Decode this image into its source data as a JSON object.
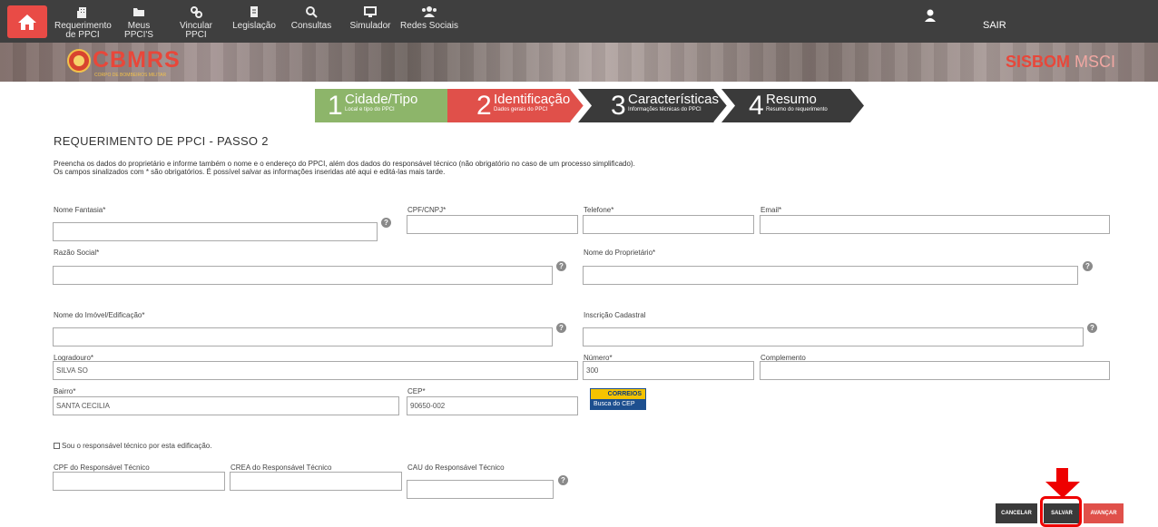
{
  "nav": {
    "items": [
      {
        "label": "Requerimento de PPCI",
        "icon": "building-icon"
      },
      {
        "label": "Meus PPCI'S",
        "icon": "folder-icon"
      },
      {
        "label": "Vincular PPCI",
        "icon": "link-icon"
      },
      {
        "label": "Legislação",
        "icon": "document-icon"
      },
      {
        "label": "Consultas",
        "icon": "search-icon"
      },
      {
        "label": "Simulador",
        "icon": "monitor-icon"
      },
      {
        "label": "Redes Sociais",
        "icon": "users-icon"
      }
    ],
    "logout": "SAIR"
  },
  "banner": {
    "brand": "CBMRS",
    "brand_sub": "CORPO DE BOMBEIROS MILITAR",
    "system": "SISBOM",
    "system_suffix": "MSCI"
  },
  "steps": [
    {
      "num": "1",
      "title": "Cidade/Tipo",
      "subtitle": "Local e tipo do PPCI",
      "color": "#8db56a"
    },
    {
      "num": "2",
      "title": "Identificação",
      "subtitle": "Dados gerais do PPCI",
      "color": "#e0504a"
    },
    {
      "num": "3",
      "title": "Características",
      "subtitle": "Informações técnicas do PPCI",
      "color": "#3a3a3a"
    },
    {
      "num": "4",
      "title": "Resumo",
      "subtitle": "Resumo do requerimento",
      "color": "#3a3a3a"
    }
  ],
  "page": {
    "title": "REQUERIMENTO DE PPCI - PASSO 2",
    "intro_line1": "Preencha os dados do proprietário e informe também o nome e o endereço do PPCI, além dos dados do responsável técnico (não obrigatório no caso de um processo simplificado).",
    "intro_line2": "Os campos sinalizados com * são obrigatórios. É possível salvar as informações inseridas até aqui e editá-las mais tarde."
  },
  "fields": {
    "nome_fantasia": {
      "label": "Nome Fantasia*",
      "value": ""
    },
    "cpf_cnpj": {
      "label": "CPF/CNPJ*",
      "value": ""
    },
    "telefone": {
      "label": "Telefone*",
      "value": ""
    },
    "email": {
      "label": "Email*",
      "value": ""
    },
    "razao_social": {
      "label": "Razão Social*",
      "value": ""
    },
    "nome_proprietario": {
      "label": "Nome do Proprietário*",
      "value": ""
    },
    "nome_imovel": {
      "label": "Nome do Imóvel/Edificação*",
      "value": ""
    },
    "inscricao": {
      "label": "Inscrição Cadastral",
      "value": ""
    },
    "logradouro": {
      "label": "Logradouro*",
      "value": "SILVA SO"
    },
    "numero": {
      "label": "Número*",
      "value": "300"
    },
    "complemento": {
      "label": "Complemento",
      "value": ""
    },
    "bairro": {
      "label": "Bairro*",
      "value": "SANTA CECILIA"
    },
    "cep": {
      "label": "CEP*",
      "value": "90650-002"
    },
    "cpf_resp": {
      "label": "CPF do Responsável Técnico",
      "value": ""
    },
    "crea_resp": {
      "label": "CREA do Responsável Técnico",
      "value": ""
    },
    "cau_resp": {
      "label": "CAU do Responsável Técnico",
      "value": ""
    }
  },
  "help_glyph": "?",
  "correios": {
    "top": "CORREIOS",
    "bottom": "Busca do CEP"
  },
  "checkbox_label": "Sou o responsável técnico por esta edificação.",
  "buttons": {
    "cancel": "CANCELAR",
    "save": "SALVAR",
    "next": "AVANÇAR"
  },
  "colors": {
    "primary_red": "#e0504a",
    "step_green": "#8db56a",
    "nav_bg": "#3f3f3f",
    "highlight": "#e00000"
  }
}
